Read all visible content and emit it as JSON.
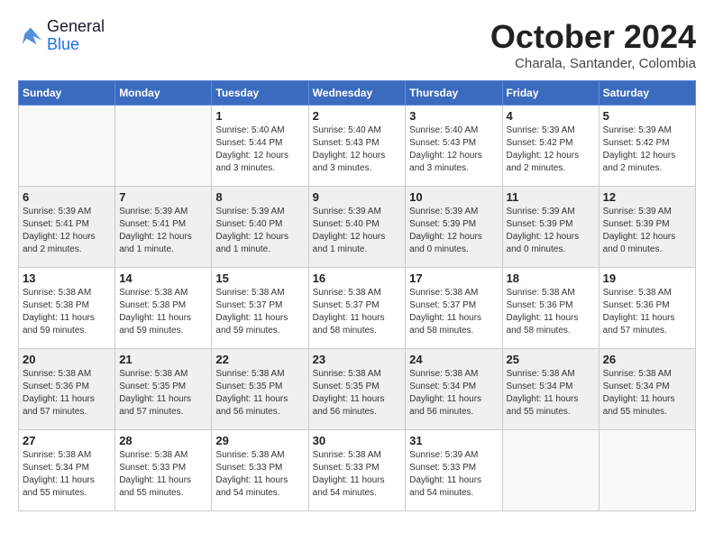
{
  "header": {
    "logo_general": "General",
    "logo_blue": "Blue",
    "month_title": "October 2024",
    "location": "Charala, Santander, Colombia"
  },
  "days_of_week": [
    "Sunday",
    "Monday",
    "Tuesday",
    "Wednesday",
    "Thursday",
    "Friday",
    "Saturday"
  ],
  "weeks": [
    [
      {
        "day": "",
        "sunrise": "",
        "sunset": "",
        "daylight": ""
      },
      {
        "day": "",
        "sunrise": "",
        "sunset": "",
        "daylight": ""
      },
      {
        "day": "1",
        "sunrise": "Sunrise: 5:40 AM",
        "sunset": "Sunset: 5:44 PM",
        "daylight": "Daylight: 12 hours and 3 minutes."
      },
      {
        "day": "2",
        "sunrise": "Sunrise: 5:40 AM",
        "sunset": "Sunset: 5:43 PM",
        "daylight": "Daylight: 12 hours and 3 minutes."
      },
      {
        "day": "3",
        "sunrise": "Sunrise: 5:40 AM",
        "sunset": "Sunset: 5:43 PM",
        "daylight": "Daylight: 12 hours and 3 minutes."
      },
      {
        "day": "4",
        "sunrise": "Sunrise: 5:39 AM",
        "sunset": "Sunset: 5:42 PM",
        "daylight": "Daylight: 12 hours and 2 minutes."
      },
      {
        "day": "5",
        "sunrise": "Sunrise: 5:39 AM",
        "sunset": "Sunset: 5:42 PM",
        "daylight": "Daylight: 12 hours and 2 minutes."
      }
    ],
    [
      {
        "day": "6",
        "sunrise": "Sunrise: 5:39 AM",
        "sunset": "Sunset: 5:41 PM",
        "daylight": "Daylight: 12 hours and 2 minutes."
      },
      {
        "day": "7",
        "sunrise": "Sunrise: 5:39 AM",
        "sunset": "Sunset: 5:41 PM",
        "daylight": "Daylight: 12 hours and 1 minute."
      },
      {
        "day": "8",
        "sunrise": "Sunrise: 5:39 AM",
        "sunset": "Sunset: 5:40 PM",
        "daylight": "Daylight: 12 hours and 1 minute."
      },
      {
        "day": "9",
        "sunrise": "Sunrise: 5:39 AM",
        "sunset": "Sunset: 5:40 PM",
        "daylight": "Daylight: 12 hours and 1 minute."
      },
      {
        "day": "10",
        "sunrise": "Sunrise: 5:39 AM",
        "sunset": "Sunset: 5:39 PM",
        "daylight": "Daylight: 12 hours and 0 minutes."
      },
      {
        "day": "11",
        "sunrise": "Sunrise: 5:39 AM",
        "sunset": "Sunset: 5:39 PM",
        "daylight": "Daylight: 12 hours and 0 minutes."
      },
      {
        "day": "12",
        "sunrise": "Sunrise: 5:39 AM",
        "sunset": "Sunset: 5:39 PM",
        "daylight": "Daylight: 12 hours and 0 minutes."
      }
    ],
    [
      {
        "day": "13",
        "sunrise": "Sunrise: 5:38 AM",
        "sunset": "Sunset: 5:38 PM",
        "daylight": "Daylight: 11 hours and 59 minutes."
      },
      {
        "day": "14",
        "sunrise": "Sunrise: 5:38 AM",
        "sunset": "Sunset: 5:38 PM",
        "daylight": "Daylight: 11 hours and 59 minutes."
      },
      {
        "day": "15",
        "sunrise": "Sunrise: 5:38 AM",
        "sunset": "Sunset: 5:37 PM",
        "daylight": "Daylight: 11 hours and 59 minutes."
      },
      {
        "day": "16",
        "sunrise": "Sunrise: 5:38 AM",
        "sunset": "Sunset: 5:37 PM",
        "daylight": "Daylight: 11 hours and 58 minutes."
      },
      {
        "day": "17",
        "sunrise": "Sunrise: 5:38 AM",
        "sunset": "Sunset: 5:37 PM",
        "daylight": "Daylight: 11 hours and 58 minutes."
      },
      {
        "day": "18",
        "sunrise": "Sunrise: 5:38 AM",
        "sunset": "Sunset: 5:36 PM",
        "daylight": "Daylight: 11 hours and 58 minutes."
      },
      {
        "day": "19",
        "sunrise": "Sunrise: 5:38 AM",
        "sunset": "Sunset: 5:36 PM",
        "daylight": "Daylight: 11 hours and 57 minutes."
      }
    ],
    [
      {
        "day": "20",
        "sunrise": "Sunrise: 5:38 AM",
        "sunset": "Sunset: 5:36 PM",
        "daylight": "Daylight: 11 hours and 57 minutes."
      },
      {
        "day": "21",
        "sunrise": "Sunrise: 5:38 AM",
        "sunset": "Sunset: 5:35 PM",
        "daylight": "Daylight: 11 hours and 57 minutes."
      },
      {
        "day": "22",
        "sunrise": "Sunrise: 5:38 AM",
        "sunset": "Sunset: 5:35 PM",
        "daylight": "Daylight: 11 hours and 56 minutes."
      },
      {
        "day": "23",
        "sunrise": "Sunrise: 5:38 AM",
        "sunset": "Sunset: 5:35 PM",
        "daylight": "Daylight: 11 hours and 56 minutes."
      },
      {
        "day": "24",
        "sunrise": "Sunrise: 5:38 AM",
        "sunset": "Sunset: 5:34 PM",
        "daylight": "Daylight: 11 hours and 56 minutes."
      },
      {
        "day": "25",
        "sunrise": "Sunrise: 5:38 AM",
        "sunset": "Sunset: 5:34 PM",
        "daylight": "Daylight: 11 hours and 55 minutes."
      },
      {
        "day": "26",
        "sunrise": "Sunrise: 5:38 AM",
        "sunset": "Sunset: 5:34 PM",
        "daylight": "Daylight: 11 hours and 55 minutes."
      }
    ],
    [
      {
        "day": "27",
        "sunrise": "Sunrise: 5:38 AM",
        "sunset": "Sunset: 5:34 PM",
        "daylight": "Daylight: 11 hours and 55 minutes."
      },
      {
        "day": "28",
        "sunrise": "Sunrise: 5:38 AM",
        "sunset": "Sunset: 5:33 PM",
        "daylight": "Daylight: 11 hours and 55 minutes."
      },
      {
        "day": "29",
        "sunrise": "Sunrise: 5:38 AM",
        "sunset": "Sunset: 5:33 PM",
        "daylight": "Daylight: 11 hours and 54 minutes."
      },
      {
        "day": "30",
        "sunrise": "Sunrise: 5:38 AM",
        "sunset": "Sunset: 5:33 PM",
        "daylight": "Daylight: 11 hours and 54 minutes."
      },
      {
        "day": "31",
        "sunrise": "Sunrise: 5:39 AM",
        "sunset": "Sunset: 5:33 PM",
        "daylight": "Daylight: 11 hours and 54 minutes."
      },
      {
        "day": "",
        "sunrise": "",
        "sunset": "",
        "daylight": ""
      },
      {
        "day": "",
        "sunrise": "",
        "sunset": "",
        "daylight": ""
      }
    ]
  ]
}
